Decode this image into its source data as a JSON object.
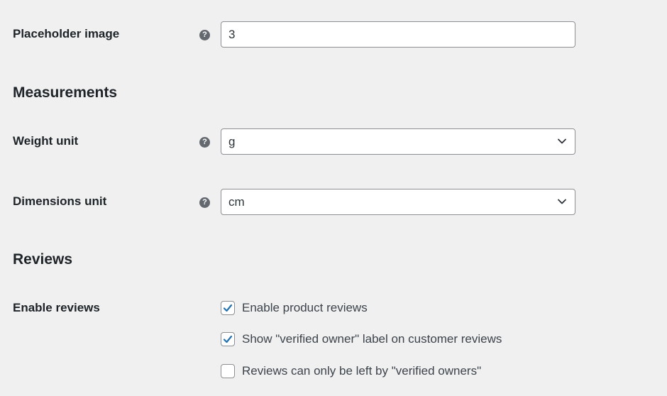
{
  "placeholder_image": {
    "label": "Placeholder image",
    "help_icon": "question-mark-icon",
    "help_glyph": "?",
    "value": "3"
  },
  "measurements": {
    "title": "Measurements",
    "weight_unit": {
      "label": "Weight unit",
      "help_icon": "question-mark-icon",
      "help_glyph": "?",
      "selected": "g"
    },
    "dimensions_unit": {
      "label": "Dimensions unit",
      "help_icon": "question-mark-icon",
      "help_glyph": "?",
      "selected": "cm"
    }
  },
  "reviews": {
    "title": "Reviews",
    "enable_reviews": {
      "label": "Enable reviews",
      "options": [
        {
          "label": "Enable product reviews",
          "checked": true
        },
        {
          "label": "Show \"verified owner\" label on customer reviews",
          "checked": true
        },
        {
          "label": "Reviews can only be left by \"verified owners\"",
          "checked": false
        }
      ]
    }
  },
  "colors": {
    "background": "#f0f0f1",
    "checkmark": "#2271b1",
    "border": "#8c8f94",
    "help_icon": "#646970"
  }
}
